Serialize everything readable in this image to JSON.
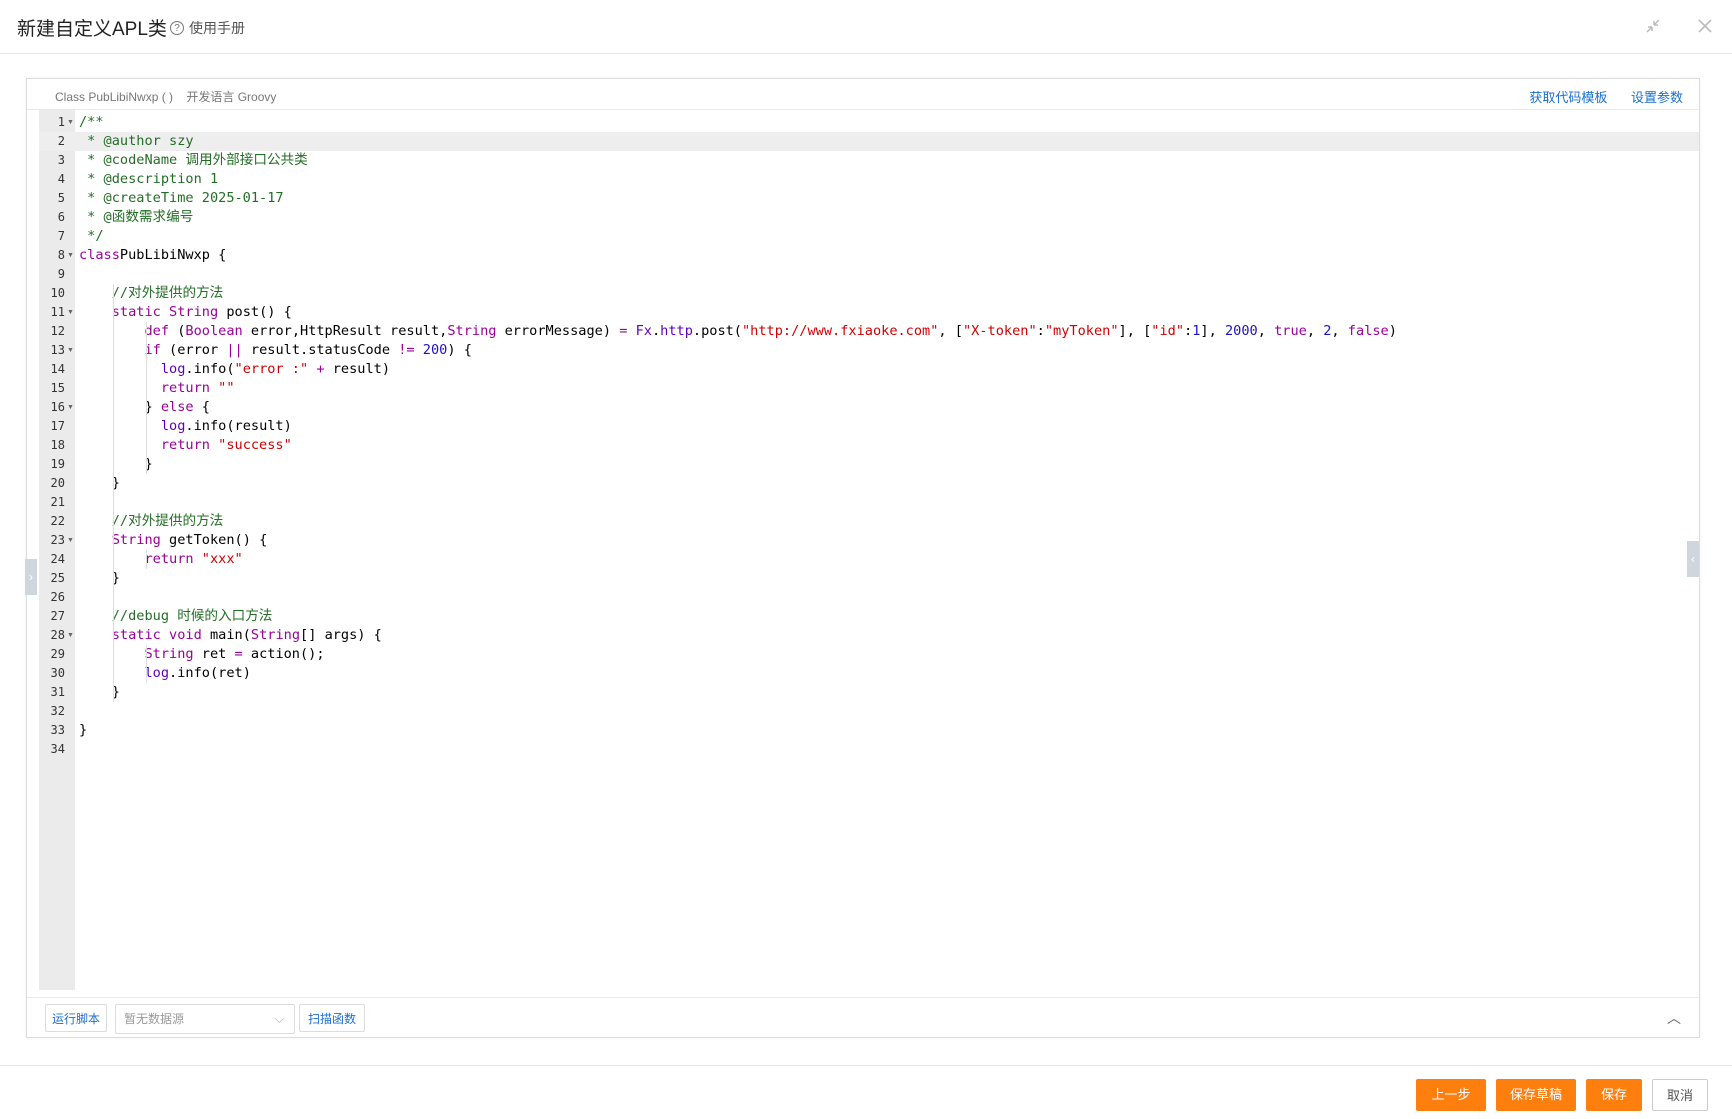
{
  "window": {
    "title": "新建自定义APL类",
    "help_label": "使用手册"
  },
  "panel": {
    "class_info": "Class PubLibiNwxp ( )",
    "language_info": "开发语言 Groovy",
    "link_template": "获取代码模板",
    "link_params": "设置参数"
  },
  "editor": {
    "active_line": 2,
    "lines": [
      {
        "n": "1",
        "fold": true,
        "tokens": [
          [
            "c-cmt",
            "/**"
          ]
        ]
      },
      {
        "n": "2",
        "tokens": [
          [
            "c-cmt",
            " * @author szy"
          ]
        ]
      },
      {
        "n": "3",
        "tokens": [
          [
            "c-cmt",
            " * @codeName 调用外部接口公共类"
          ]
        ]
      },
      {
        "n": "4",
        "tokens": [
          [
            "c-cmt",
            " * @description 1"
          ]
        ]
      },
      {
        "n": "5",
        "tokens": [
          [
            "c-cmt",
            " * @createTime 2025-01-17"
          ]
        ]
      },
      {
        "n": "6",
        "tokens": [
          [
            "c-cmt",
            " * @函数需求编号"
          ]
        ]
      },
      {
        "n": "7",
        "tokens": [
          [
            "c-cmt",
            " */"
          ]
        ]
      },
      {
        "n": "8",
        "fold": true,
        "tokens": [
          [
            "c-kw",
            "class"
          ],
          [
            "",
            "PubLibiNwxp {"
          ]
        ]
      },
      {
        "n": "9",
        "tokens": []
      },
      {
        "n": "10",
        "tokens": [
          [
            "",
            "    "
          ],
          [
            "c-cmt",
            "//对外提供的方法"
          ]
        ]
      },
      {
        "n": "11",
        "fold": true,
        "tokens": [
          [
            "",
            "    "
          ],
          [
            "c-kw",
            "static"
          ],
          [
            "",
            " "
          ],
          [
            "c-kw",
            "String"
          ],
          [
            "",
            " post() {"
          ]
        ]
      },
      {
        "n": "12",
        "tokens": [
          [
            "",
            "        "
          ],
          [
            "c-kw",
            "def"
          ],
          [
            "",
            " ("
          ],
          [
            "c-kw",
            "Boolean"
          ],
          [
            "",
            " error,HttpResult result,"
          ],
          [
            "c-kw",
            "String"
          ],
          [
            "",
            " errorMessage) "
          ],
          [
            "c-op",
            "="
          ],
          [
            "",
            " "
          ],
          [
            "c-fn",
            "Fx"
          ],
          [
            "",
            "."
          ],
          [
            "c-fn",
            "http"
          ],
          [
            "",
            ".post("
          ],
          [
            "c-str",
            "\"http://www.fxiaoke.com\""
          ],
          [
            "",
            ", ["
          ],
          [
            "c-str",
            "\"X-token\""
          ],
          [
            "",
            ":"
          ],
          [
            "c-str",
            "\"myToken\""
          ],
          [
            "",
            "], ["
          ],
          [
            "c-str",
            "\"id\""
          ],
          [
            "",
            ":"
          ],
          [
            "c-num",
            "1"
          ],
          [
            "",
            "], "
          ],
          [
            "c-num",
            "2000"
          ],
          [
            "",
            ", "
          ],
          [
            "c-kw",
            "true"
          ],
          [
            "",
            ", "
          ],
          [
            "c-num",
            "2"
          ],
          [
            "",
            ", "
          ],
          [
            "c-kw",
            "false"
          ],
          [
            "",
            ")"
          ]
        ]
      },
      {
        "n": "13",
        "fold": true,
        "tokens": [
          [
            "",
            "        "
          ],
          [
            "c-kw",
            "if"
          ],
          [
            "",
            " (error "
          ],
          [
            "c-op",
            "||"
          ],
          [
            "",
            " result.statusCode "
          ],
          [
            "c-op",
            "!="
          ],
          [
            "",
            " "
          ],
          [
            "c-num",
            "200"
          ],
          [
            "",
            ") {"
          ]
        ]
      },
      {
        "n": "14",
        "tokens": [
          [
            "",
            "          "
          ],
          [
            "c-fn",
            "log"
          ],
          [
            "",
            ".info("
          ],
          [
            "c-str",
            "\"error :\""
          ],
          [
            "",
            " "
          ],
          [
            "c-op",
            "+"
          ],
          [
            "",
            " result)"
          ]
        ]
      },
      {
        "n": "15",
        "tokens": [
          [
            "",
            "          "
          ],
          [
            "c-kw",
            "return"
          ],
          [
            "",
            " "
          ],
          [
            "c-str",
            "\"\""
          ]
        ]
      },
      {
        "n": "16",
        "fold": true,
        "tokens": [
          [
            "",
            "        } "
          ],
          [
            "c-kw",
            "else"
          ],
          [
            "",
            " {"
          ]
        ]
      },
      {
        "n": "17",
        "tokens": [
          [
            "",
            "          "
          ],
          [
            "c-fn",
            "log"
          ],
          [
            "",
            ".info(result)"
          ]
        ]
      },
      {
        "n": "18",
        "tokens": [
          [
            "",
            "          "
          ],
          [
            "c-kw",
            "return"
          ],
          [
            "",
            " "
          ],
          [
            "c-str",
            "\"success\""
          ]
        ]
      },
      {
        "n": "19",
        "tokens": [
          [
            "",
            "        }"
          ]
        ]
      },
      {
        "n": "20",
        "tokens": [
          [
            "",
            "    }"
          ]
        ]
      },
      {
        "n": "21",
        "tokens": []
      },
      {
        "n": "22",
        "tokens": [
          [
            "",
            "    "
          ],
          [
            "c-cmt",
            "//对外提供的方法"
          ]
        ]
      },
      {
        "n": "23",
        "fold": true,
        "tokens": [
          [
            "",
            "    "
          ],
          [
            "c-kw",
            "String"
          ],
          [
            "",
            " getToken() {"
          ]
        ]
      },
      {
        "n": "24",
        "tokens": [
          [
            "",
            "        "
          ],
          [
            "c-kw",
            "return"
          ],
          [
            "",
            " "
          ],
          [
            "c-str",
            "\"xxx\""
          ]
        ]
      },
      {
        "n": "25",
        "tokens": [
          [
            "",
            "    }"
          ]
        ]
      },
      {
        "n": "26",
        "tokens": []
      },
      {
        "n": "27",
        "tokens": [
          [
            "",
            "    "
          ],
          [
            "c-cmt",
            "//debug 时候的入口方法"
          ]
        ]
      },
      {
        "n": "28",
        "fold": true,
        "tokens": [
          [
            "",
            "    "
          ],
          [
            "c-kw",
            "static"
          ],
          [
            "",
            " "
          ],
          [
            "c-kw",
            "void"
          ],
          [
            "",
            " main("
          ],
          [
            "c-kw",
            "String"
          ],
          [
            "",
            "[] args) {"
          ]
        ]
      },
      {
        "n": "29",
        "tokens": [
          [
            "",
            "        "
          ],
          [
            "c-kw",
            "String"
          ],
          [
            "",
            " ret "
          ],
          [
            "c-op",
            "="
          ],
          [
            "",
            " action();"
          ]
        ]
      },
      {
        "n": "30",
        "tokens": [
          [
            "",
            "        "
          ],
          [
            "c-fn",
            "log"
          ],
          [
            "",
            ".info(ret)"
          ]
        ]
      },
      {
        "n": "31",
        "tokens": [
          [
            "",
            "    }"
          ]
        ]
      },
      {
        "n": "32",
        "tokens": []
      },
      {
        "n": "33",
        "tokens": [
          [
            "",
            "}"
          ]
        ]
      },
      {
        "n": "34",
        "tokens": []
      }
    ]
  },
  "toolbar": {
    "run_label": "运行脚本",
    "datasource_placeholder": "暂无数据源",
    "scan_label": "扫描函数"
  },
  "footer": {
    "prev_label": "上一步",
    "draft_label": "保存草稿",
    "save_label": "保存",
    "cancel_label": "取消"
  },
  "colors": {
    "accent_orange": "#ff7f0e",
    "link_blue": "#1a6fd1"
  }
}
